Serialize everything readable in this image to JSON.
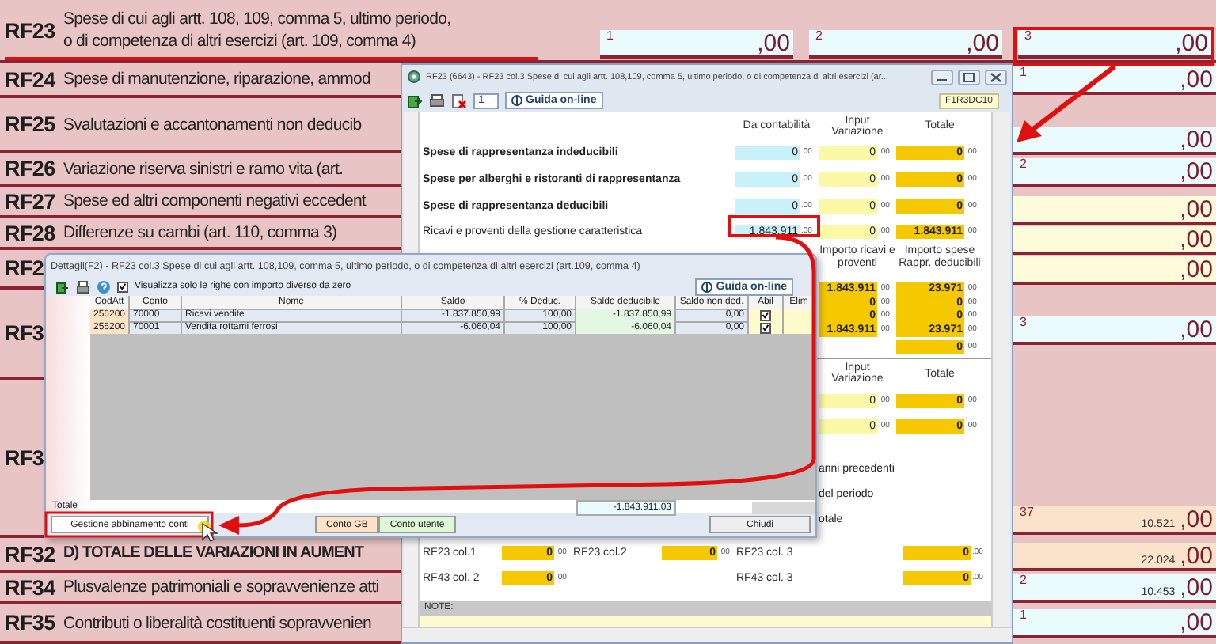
{
  "form": {
    "rows": [
      {
        "code": "RF23",
        "bold": false,
        "lines": [
          "Spese di cui agli artt. 108, 109, comma 5, ultimo periodo,",
          "o di competenza di altri esercizi (art. 109, comma 4)"
        ],
        "fields": [
          {
            "number": "1",
            "value": ",00",
            "kind": "computed"
          },
          {
            "number": "2",
            "value": ",00",
            "kind": "computed"
          },
          {
            "number": "3",
            "value": ",00",
            "kind": "computed"
          }
        ]
      },
      {
        "code": "RF24",
        "bold": false,
        "lines": [
          "Spese di manutenzione, riparazione, ammod"
        ]
      },
      {
        "code": "RF25",
        "bold": false,
        "lines": [
          "Svalutazioni e accantonamenti non deducib"
        ]
      },
      {
        "code": "RF26",
        "bold": false,
        "lines": [
          "Variazione riserva sinistri e ramo vita (art."
        ]
      },
      {
        "code": "RF27",
        "bold": false,
        "lines": [
          "Spese ed altri componenti negativi eccedent"
        ]
      },
      {
        "code": "RF28",
        "bold": false,
        "lines": [
          "Differenze su cambi (art. 110, comma 3)"
        ]
      },
      {
        "code": "RF2"
      },
      {
        "code": "RF3"
      },
      {
        "code": "RF3"
      },
      {
        "code": "RF32",
        "bold": true,
        "lines": [
          "D) TOTALE DELLE VARIAZIONI IN AUMENT"
        ]
      },
      {
        "code": "RF34",
        "bold": false,
        "lines": [
          "Plusvalenze patrimoniali e sopravvenienze atti"
        ]
      },
      {
        "code": "RF35",
        "bold": false,
        "lines": [
          "Contributi o liberalità costituenti sopravvenien"
        ]
      }
    ],
    "side_fields": [
      {
        "number": "1",
        "value": ",00",
        "kind": "computed"
      },
      {
        "value": ",00",
        "kind": "computed"
      },
      {
        "number": "2",
        "value": ",00",
        "kind": "computed"
      },
      {
        "value": ",00",
        "kind": "input"
      },
      {
        "value": ",00",
        "kind": "input"
      },
      {
        "value": ",00",
        "kind": "input"
      },
      {
        "number": "3",
        "value": ",00",
        "kind": "computed"
      },
      {
        "number": "37",
        "amount": "10.521",
        "value": ",00",
        "kind": "total"
      },
      {
        "amount": "22.024",
        "value": ",00",
        "kind": "total"
      },
      {
        "number": "2",
        "amount": "10.453",
        "value": ",00",
        "kind": "computed"
      },
      {
        "number": "1",
        "value": ",00",
        "kind": "computed"
      }
    ]
  },
  "main_window": {
    "title": "RF23 (6643) - RF23 col.3 Spese di cui agli artt. 108,109, comma 5, ultimo periodo, o di competenza di altri esercizi (ar...",
    "page": "1",
    "help_button": "Guida on-line",
    "code_badge": "F1R3DC10",
    "columns": [
      "Da contabilità",
      "Input Variazione",
      "Totale"
    ],
    "rows": [
      {
        "label": "Spese di rappresentanza indeducibili",
        "bold": true,
        "values": [
          "0 .00",
          "0 .00",
          "0 .00"
        ]
      },
      {
        "label": "Spese per alberghi e ristoranti di rappresentanza",
        "bold": true,
        "values": [
          "0 .00",
          "0 .00",
          "0 .00"
        ]
      },
      {
        "label": "Spese di rappresentanza deducibili",
        "bold": true,
        "values": [
          "0 .00",
          "0 .00",
          "0 .00"
        ]
      },
      {
        "label": "Ricavi e proventi della gestione caratteristica",
        "bold": false,
        "values": [
          "1.843.911 .00",
          "0 .00",
          "1.843.911 .00"
        ]
      }
    ],
    "ratio_columns": [
      "Importo ricavi e proventi",
      "Importo spese Rappr. deducibili"
    ],
    "ratio_rows": [
      [
        "1.843.911 .00",
        "23.971 .00"
      ],
      [
        "0 .00",
        "0 .00"
      ],
      [
        "0 .00",
        "0 .00"
      ],
      [
        "1.843.911 .00",
        "23.971 .00"
      ]
    ],
    "ratio_total": "0 .00",
    "variation_columns": [
      "Input Variazione",
      "Totale"
    ],
    "variation_rows": [
      [
        "0 .00",
        "0 .00"
      ],
      [
        "0 .00",
        "0 .00"
      ]
    ],
    "cut_labels": [
      "anni precedenti",
      "del periodo",
      "otale"
    ],
    "summary_rows": [
      [
        {
          "label": "RF23 col.1",
          "value": "0 .00"
        },
        {
          "label": "RF23 col.2",
          "value": "0 .00"
        },
        {
          "label": "RF23 col. 3",
          "value": "0 .00"
        }
      ],
      [
        {
          "label": "RF43 col. 2",
          "value": "0 .00"
        },
        {
          "label": "RF43 col. 3",
          "value": "0 .00"
        }
      ]
    ],
    "note_label": "NOTE:"
  },
  "detail_window": {
    "title": "Dettagli(F2) - RF23 col.3 Spese di cui agli artt. 108,109, comma 5, ultimo periodo, o di competenza di altri esercizi (art.109, comma 4)",
    "filter": {
      "label": "Visualizza solo le righe con importo diverso da zero",
      "checked": true
    },
    "help_button": "Guida on-line",
    "columns": [
      "CodAtt",
      "Conto",
      "Nome",
      "Saldo",
      "% Deduc.",
      "Saldo deducibile",
      "Saldo non ded.",
      "Abil",
      "Elim"
    ],
    "rows": [
      {
        "cells": [
          "256200",
          "70000",
          "Ricavi vendite",
          "-1.837.850,99",
          "100,00",
          "-1.837.850,99",
          "0,00"
        ],
        "enabled": true
      },
      {
        "cells": [
          "256200",
          "70001",
          "Vendita rottami ferrosi",
          "-6.060,04",
          "100,00",
          "-6.060,04",
          "0,00"
        ],
        "enabled": true
      }
    ],
    "total_label": "Totale",
    "total_value": "-1.843.911,03",
    "buttons": [
      {
        "label": "Gestione abbinamento conti",
        "kind": "action"
      },
      {
        "label": "Conto GB",
        "kind": "account"
      },
      {
        "label": "Conto utente",
        "kind": "user"
      },
      {
        "label": "Chiudi",
        "kind": "close"
      }
    ]
  }
}
